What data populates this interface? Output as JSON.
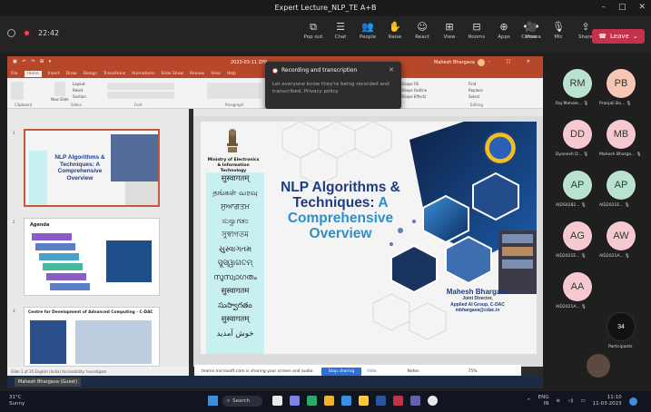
{
  "window": {
    "title": "Expert Lecture_NLP_TE A+B",
    "controls": [
      "–",
      "□",
      "✕"
    ]
  },
  "meeting": {
    "timer": "22:42",
    "tools": [
      {
        "icon": "popout-icon",
        "glyph": "⧉",
        "label": "Pop out"
      },
      {
        "icon": "chat-icon",
        "glyph": "☰",
        "label": "Chat"
      },
      {
        "icon": "people-icon",
        "glyph": "👥",
        "label": "People"
      },
      {
        "icon": "raise-hand-icon",
        "glyph": "✋",
        "label": "Raise"
      },
      {
        "icon": "react-icon",
        "glyph": "☺",
        "label": "React"
      },
      {
        "icon": "view-icon",
        "glyph": "⊞",
        "label": "View"
      },
      {
        "icon": "rooms-icon",
        "glyph": "⊟",
        "label": "Rooms"
      },
      {
        "icon": "apps-icon",
        "glyph": "⊕",
        "label": "Apps"
      },
      {
        "icon": "more-icon",
        "glyph": "•••",
        "label": "More"
      }
    ],
    "av_tools": [
      {
        "icon": "camera-icon",
        "glyph": "🎥",
        "label": "Camera"
      },
      {
        "icon": "mic-icon",
        "glyph": "🎙",
        "label": "Mic"
      },
      {
        "icon": "share-icon",
        "glyph": "⇪",
        "label": "Share"
      }
    ],
    "leave_label": "Leave",
    "leave_color": "#c4314b"
  },
  "recording_popup": {
    "title": "Recording and transcription",
    "body": "Let everyone know they're being recorded and transcribed. Privacy policy"
  },
  "powerpoint": {
    "file_name": "2023-03-11 ZPP",
    "user": "Mahesh Bhargava",
    "tabs": [
      "File",
      "Home",
      "Insert",
      "Draw",
      "Design",
      "Transitions",
      "Animations",
      "Slide Show",
      "Review",
      "View",
      "Help"
    ],
    "active_tab": "Home",
    "ribbon_groups": [
      "Clipboard",
      "Slides",
      "Font",
      "Paragraph",
      "Drawing",
      "Editing"
    ],
    "ribbon_labels": {
      "layout": "Layout",
      "reset": "Reset",
      "section": "Section",
      "new_slide": "New Slide",
      "find": "Find",
      "replace": "Replace",
      "select": "Select",
      "arrange": "Arrange",
      "quick_styles": "Quick Styles",
      "shape_fill": "Shape Fill",
      "shape_outline": "Shape Outline",
      "shape_effects": "Shape Effects"
    },
    "thumbnails": [
      {
        "num": "1",
        "title": "NLP Algorithms & Techniques: A Comprehensive Overview"
      },
      {
        "num": "2",
        "title": "Agenda"
      },
      {
        "num": "3",
        "title": "Centre for Development of Advanced Computing - C-DAC"
      }
    ],
    "status": "Slide 1 of 35   English (India)   Accessibility: Investigate",
    "notes": "Notes",
    "zoom": "75%"
  },
  "slide": {
    "ministry": "Ministry of Electronics & Information Technology",
    "scripts": [
      "सुस्वागतम्",
      "தங்கள் வரவு",
      "ਸੁਆਗਤਮ",
      "ಸುಸ್ವಾಗತಂ",
      "সুস্বাগতম",
      "સુસ્વાગતમ",
      "ସୁସ୍ୱାଗତମ୍",
      "സുസ്വാഗതം",
      "सुस्वागतम",
      "సుస్వాగతం",
      "सुस्वागतम्",
      "خوش آمدید"
    ],
    "title_line1": "NLP Algorithms &",
    "title_line2a": "Techniques: ",
    "title_line2b": "A",
    "title_line3": "Comprehensive",
    "title_line4": "Overview",
    "presenter_name": "Mahesh Bhargava",
    "presenter_role1": "Joint Director,",
    "presenter_role2": "Applied AI Group, C-DAC",
    "presenter_email": "mbhargava@cdac.in"
  },
  "share_bar": {
    "message": "teams.microsoft.com is sharing your screen and audio.",
    "stop_label": "Stop sharing",
    "hide_label": "Hide"
  },
  "presenter_tag": "Mahesh Bhargava (Guest)",
  "participants": [
    {
      "initials": "RM",
      "name": "Raj Mahale...",
      "color": "#b9e3cf"
    },
    {
      "initials": "PB",
      "name": "Pranjali Ba...",
      "color": "#f7c7b3"
    },
    {
      "initials": "DD",
      "name": "Dyanesh D...",
      "color": "#f6c9d0"
    },
    {
      "initials": "MB",
      "name": "Mahesh Bharga...",
      "color": "#f6c9d0"
    },
    {
      "initials": "AP",
      "name": "AIDS0282...",
      "color": "#b9e3cf"
    },
    {
      "initials": "AP",
      "name": "AID2021E...",
      "color": "#b9e3cf"
    },
    {
      "initials": "AG",
      "name": "AID2021E...",
      "color": "#f6c9d0"
    },
    {
      "initials": "AW",
      "name": "AID2021A...",
      "color": "#f6c9d0"
    },
    {
      "initials": "AA",
      "name": "AID2021A...",
      "color": "#f6c9d0"
    }
  ],
  "participants_count": {
    "count": "34",
    "label": "Participants"
  },
  "taskbar": {
    "temp": "31°C",
    "weather": "Sunny",
    "search": "Search",
    "lang1": "ENG",
    "lang2": "IN",
    "time": "11:10",
    "date": "11-03-2023"
  }
}
